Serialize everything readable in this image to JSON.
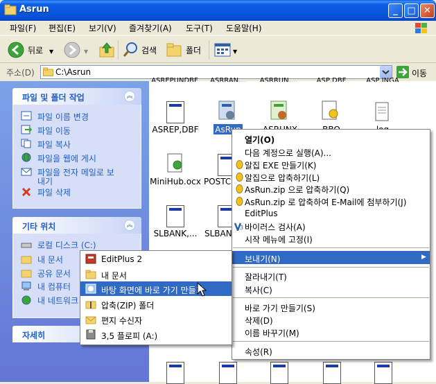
{
  "window": {
    "title": "Asrun",
    "btn_min": "_",
    "btn_max": "□",
    "btn_close": "✕"
  },
  "menubar": [
    "파일(F)",
    "편집(E)",
    "보기(V)",
    "즐겨찾기(A)",
    "도구(T)",
    "도움말(H)"
  ],
  "toolbar": {
    "back": "뒤로",
    "search": "검색",
    "folders": "폴더"
  },
  "address": {
    "label": "주소(D)",
    "path": "C:\\Asrun",
    "go": "이동"
  },
  "left_panel": {
    "tasks": {
      "title": "파일 및 폴더 작업",
      "items": [
        "파일 이름 변경",
        "파일 이동",
        "파일 복사",
        "파일을 웹에 게시",
        "파일을 전자 메일로 보",
        "내기",
        "파일 삭제"
      ]
    },
    "places": {
      "title": "기타 위치",
      "items": [
        "로컬 디스크 (C:)",
        "내 문서",
        "공유 문서",
        "내 컴퓨터",
        "내 네트워크"
      ]
    },
    "details": {
      "title": "자세히"
    }
  },
  "files": {
    "top_partial": [
      "ASREPUNDBF",
      "ASRRAN,...",
      "ASRRUN,...",
      "ASP,DBF",
      "ASP,INGA"
    ],
    "row1": [
      "ASREP,DBF",
      "AsRun",
      "ASRUNX",
      "BBO",
      "log"
    ],
    "row2": [
      "MiniHub.ocx",
      "POSTC"
    ],
    "row3": [
      "SLBANK,...",
      "SLBAN"
    ]
  },
  "context_menu": {
    "items": [
      {
        "label": "열기(O)",
        "bold": true
      },
      {
        "label": "다음 계정으로 실행(A)..."
      },
      {
        "label": "알집 EXE 만들기(K)",
        "icon": "alzip"
      },
      {
        "label": "알집으로 압축하기(L)",
        "icon": "alzip"
      },
      {
        "label": "AsRun.zip 으로 압축하기(Q)",
        "icon": "alzip"
      },
      {
        "label": "AsRun.zip 로 압축하여 E-Mail에 첨부하기(J)",
        "icon": "alzip"
      },
      {
        "label": "EditPlus"
      },
      {
        "label": "바이러스 검사(A)",
        "icon": "v3"
      },
      {
        "label": "시작 메뉴에 고정(I)"
      },
      {
        "label": "보내기(N)",
        "highlight": true,
        "submenu": true
      },
      {
        "label": "잘라내기(T)"
      },
      {
        "label": "복사(C)"
      },
      {
        "label": "바로 가기 만들기(S)"
      },
      {
        "label": "삭제(D)"
      },
      {
        "label": "이름 바꾸기(M)"
      },
      {
        "label": "속성(R)"
      }
    ]
  },
  "submenu": {
    "items": [
      {
        "label": "EditPlus 2"
      },
      {
        "label": "내 문서"
      },
      {
        "label": "바탕 화면에 바로 가기 만들기",
        "highlight": true
      },
      {
        "label": "압축(ZIP) 폴더"
      },
      {
        "label": "편지 수신자"
      },
      {
        "label": "3,5 플로피 (A:)"
      }
    ]
  },
  "colors": {
    "selection": "#316ac5",
    "titlebar": "#0a5fe8",
    "link": "#215dc6"
  }
}
